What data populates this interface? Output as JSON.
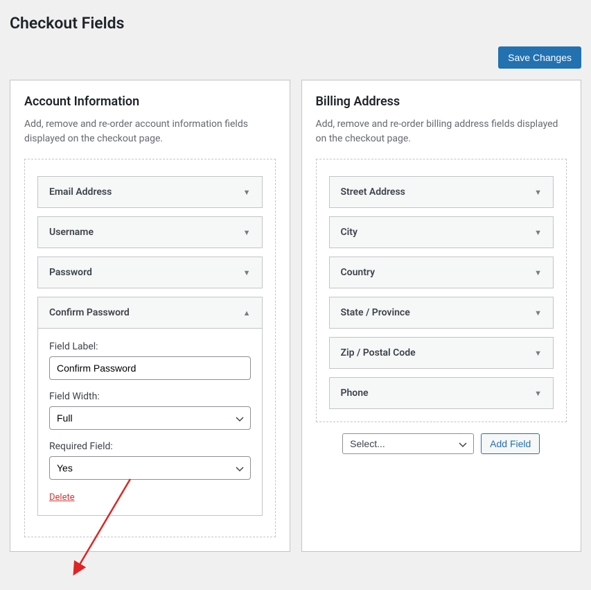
{
  "page_title": "Checkout Fields",
  "save_button": "Save Changes",
  "panels": {
    "account": {
      "title": "Account Information",
      "description": "Add, remove and re-order account information fields displayed on the checkout page.",
      "fields": [
        {
          "label": "Email Address",
          "expanded": false
        },
        {
          "label": "Username",
          "expanded": false
        },
        {
          "label": "Password",
          "expanded": false
        },
        {
          "label": "Confirm Password",
          "expanded": true
        }
      ],
      "expanded_detail": {
        "field_label_text": "Field Label:",
        "field_label_value": "Confirm Password",
        "field_width_text": "Field Width:",
        "field_width_value": "Full",
        "required_text": "Required Field:",
        "required_value": "Yes",
        "delete_text": "Delete"
      }
    },
    "billing": {
      "title": "Billing Address",
      "description": "Add, remove and re-order billing address fields displayed on the checkout page.",
      "fields": [
        {
          "label": "Street Address"
        },
        {
          "label": "City"
        },
        {
          "label": "Country"
        },
        {
          "label": "State / Province"
        },
        {
          "label": "Zip / Postal Code"
        },
        {
          "label": "Phone"
        }
      ],
      "add_field": {
        "select_placeholder": "Select...",
        "button_label": "Add Field"
      }
    }
  }
}
